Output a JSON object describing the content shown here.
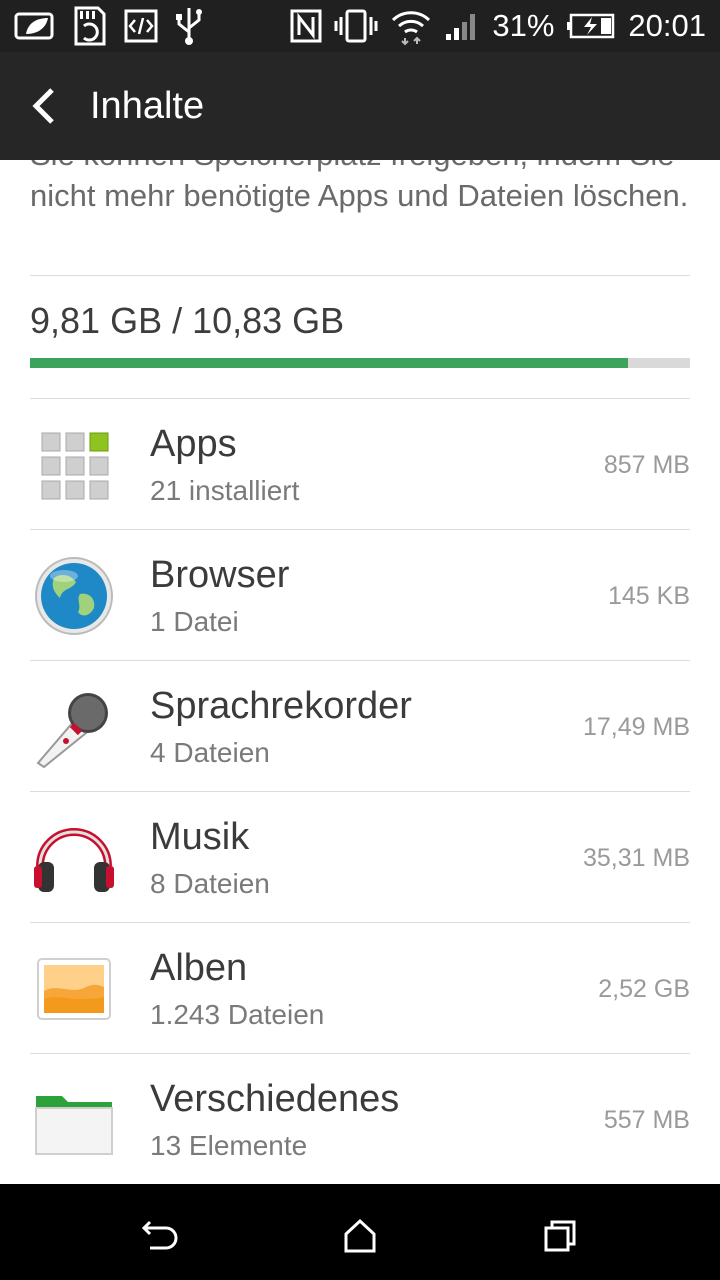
{
  "statusbar": {
    "battery_percent": "31%",
    "time": "20:01",
    "icons": [
      "leaf-icon",
      "sd-card-sync-icon",
      "code-icon",
      "usb-icon",
      "nfc-icon",
      "vibrate-icon",
      "wifi-icon",
      "signal-icon",
      "battery-charging-icon"
    ]
  },
  "header": {
    "title": "Inhalte"
  },
  "intro_text": "Sie können Speicherplatz freigeben, indem Sie nicht mehr benötigte Apps und Dateien löschen.",
  "storage": {
    "summary": "9,81 GB / 10,83 GB",
    "used_fraction": 0.906,
    "bar_color": "#3aa35c"
  },
  "categories": [
    {
      "name": "Apps",
      "detail": "21 installiert",
      "size": "857 MB",
      "icon": "apps-grid-icon"
    },
    {
      "name": "Browser",
      "detail": "1 Datei",
      "size": "145 KB",
      "icon": "globe-icon"
    },
    {
      "name": "Sprachrekorder",
      "detail": "4 Dateien",
      "size": "17,49 MB",
      "icon": "microphone-icon"
    },
    {
      "name": "Musik",
      "detail": "8 Dateien",
      "size": "35,31 MB",
      "icon": "headphones-icon"
    },
    {
      "name": "Alben",
      "detail": "1.243 Dateien",
      "size": "2,52 GB",
      "icon": "photo-album-icon"
    },
    {
      "name": "Verschiedenes",
      "detail": "13 Elemente",
      "size": "557 MB",
      "icon": "folder-icon"
    }
  ],
  "navbar": {
    "icons": [
      "back-nav-icon",
      "home-nav-icon",
      "recents-nav-icon"
    ]
  }
}
